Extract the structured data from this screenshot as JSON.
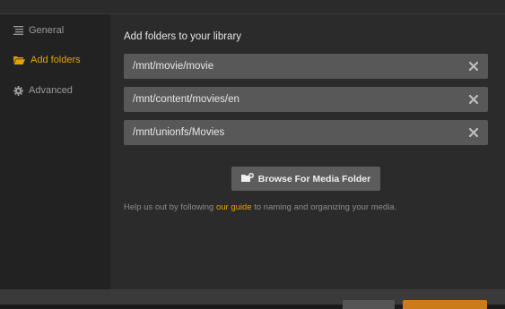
{
  "sidebar": {
    "items": [
      {
        "label": "General",
        "icon": "list-icon",
        "active": false
      },
      {
        "label": "Add folders",
        "icon": "folder-icon",
        "active": true
      },
      {
        "label": "Advanced",
        "icon": "gear-icon",
        "active": false
      }
    ]
  },
  "main": {
    "heading": "Add folders to your library",
    "folders": [
      "/mnt/movie/movie",
      "/mnt/content/movies/en",
      "/mnt/unionfs/Movies"
    ],
    "browse_label": "Browse For Media Folder",
    "help": {
      "before": "Help us out by following ",
      "link": "our guide",
      "after": " to naming and organizing your media."
    }
  },
  "colors": {
    "accent": "#e5a00d",
    "row_background": "#585858",
    "primary_button": "#cc7b19"
  }
}
